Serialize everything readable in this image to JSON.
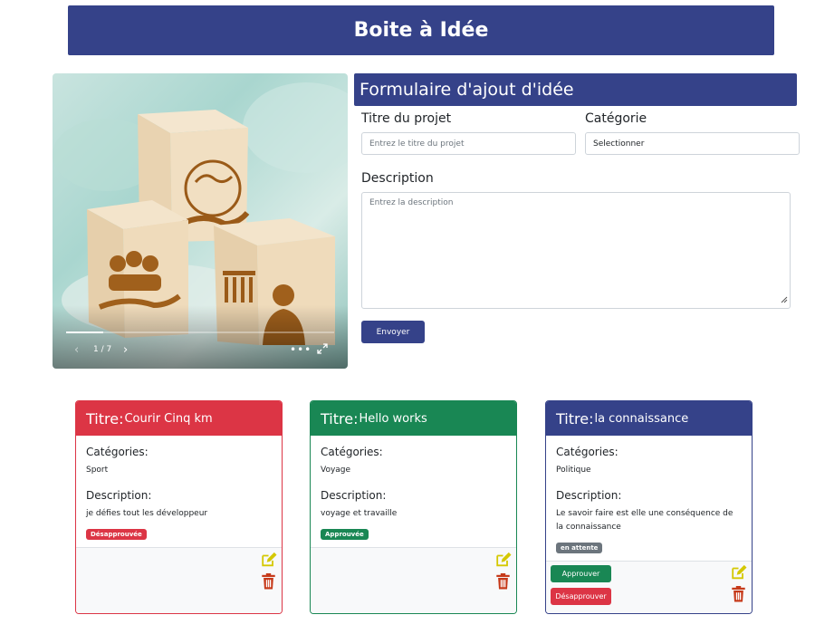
{
  "header": {
    "title": "Boite à Idée"
  },
  "carousel": {
    "counter": "1 / 7",
    "prev_glyph": "‹",
    "next_glyph": "›",
    "more_glyph": "•••",
    "progress": 0.14
  },
  "form": {
    "title": "Formulaire d'ajout d'idée",
    "title_label": "Titre du projet",
    "title_placeholder": "Entrez le titre du projet",
    "category_label": "Catégorie",
    "category_selected": "Selectionner",
    "description_label": "Description",
    "description_placeholder": "Entrez la description",
    "submit_label": "Envoyer"
  },
  "colors": {
    "primary": "#354289",
    "danger": "#dc3545",
    "success": "#198754",
    "secondary": "#6c757d",
    "edit_icon": "#d4c800",
    "trash_icon": "#c63a1a"
  },
  "cards": [
    {
      "title_prefix": "Titre:",
      "title": "Courir Cinq km",
      "categories_label": "Catégories:",
      "category": "Sport",
      "description_label": "Description:",
      "description": "je défies tout les développeur",
      "status": "Désapprouvée",
      "status_color": "#dc3545",
      "theme": "#dc3545"
    },
    {
      "title_prefix": "Titre:",
      "title": "Hello works",
      "categories_label": "Catégories:",
      "category": "Voyage",
      "description_label": "Description:",
      "description": "voyage et travaille",
      "status": "Approuvée",
      "status_color": "#198754",
      "theme": "#198754"
    },
    {
      "title_prefix": "Titre:",
      "title": "la connaissance",
      "categories_label": "Catégories:",
      "category": "Politique",
      "description_label": "Description:",
      "description": "Le savoir faire est elle une conséquence de la connaissance",
      "status": "en attente",
      "status_color": "#6c757d",
      "theme": "#354289",
      "approve_label": "Approuver",
      "disapprove_label": "Désapprouver"
    }
  ]
}
